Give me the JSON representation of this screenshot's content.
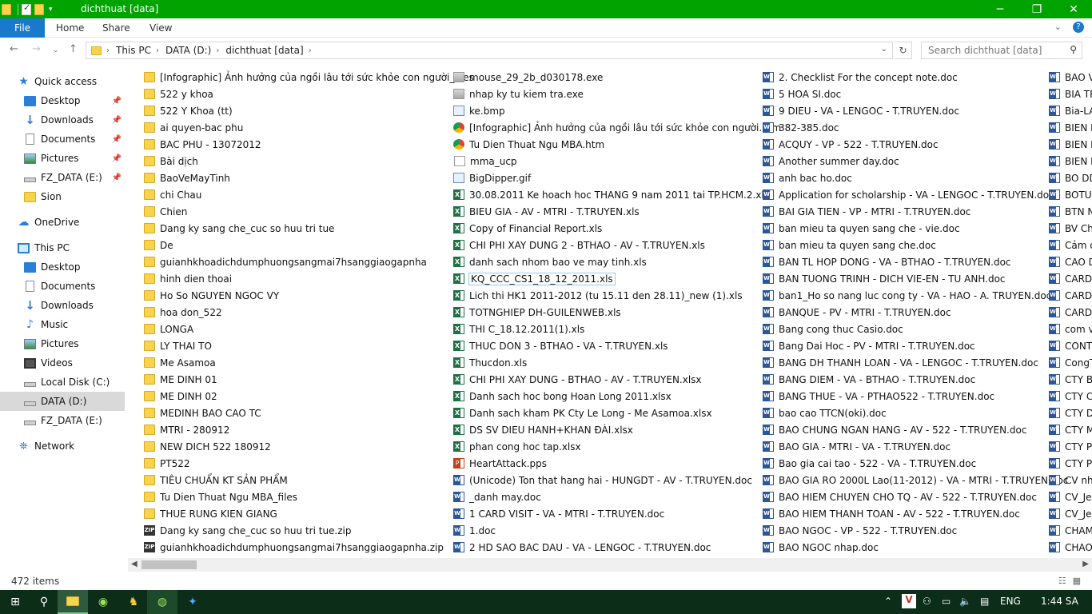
{
  "window": {
    "title": "dichthuat [data]"
  },
  "ribbon": {
    "file": "File",
    "tabs": [
      "Home",
      "Share",
      "View"
    ]
  },
  "address": {
    "segments": [
      "This PC",
      "DATA (D:)",
      "dichthuat [data]"
    ]
  },
  "search": {
    "placeholder": "Search dichthuat [data]"
  },
  "sidebar": {
    "items": [
      {
        "label": "Quick access",
        "icon": "star-icon",
        "pinned": false
      },
      {
        "label": "Desktop",
        "icon": "desktop-icon",
        "pinned": true
      },
      {
        "label": "Downloads",
        "icon": "download-icon",
        "pinned": true
      },
      {
        "label": "Documents",
        "icon": "documents-icon",
        "pinned": true
      },
      {
        "label": "Pictures",
        "icon": "pictures-icon",
        "pinned": true
      },
      {
        "label": "FZ_DATA (E:)",
        "icon": "drive-icon",
        "pinned": true
      },
      {
        "label": "Sion",
        "icon": "folder-icon",
        "pinned": false
      },
      {
        "label": "OneDrive",
        "icon": "cloud-icon",
        "pinned": false
      },
      {
        "label": "This PC",
        "icon": "pc-icon",
        "pinned": false
      },
      {
        "label": "Desktop",
        "icon": "desktop-icon",
        "pinned": false
      },
      {
        "label": "Documents",
        "icon": "documents-icon",
        "pinned": false
      },
      {
        "label": "Downloads",
        "icon": "download-icon",
        "pinned": false
      },
      {
        "label": "Music",
        "icon": "music-icon",
        "pinned": false
      },
      {
        "label": "Pictures",
        "icon": "pictures-icon",
        "pinned": false
      },
      {
        "label": "Videos",
        "icon": "videos-icon",
        "pinned": false
      },
      {
        "label": "Local Disk (C:)",
        "icon": "drive-icon",
        "pinned": false
      },
      {
        "label": "DATA (D:)",
        "icon": "drive-icon",
        "pinned": false,
        "selected": true
      },
      {
        "label": "FZ_DATA (E:)",
        "icon": "drive-icon",
        "pinned": false
      },
      {
        "label": "Network",
        "icon": "network-icon",
        "pinned": false
      }
    ]
  },
  "files": {
    "col1": [
      {
        "name": "[Infographic] Ảnh hưởng của ngồi lâu tới sức khỏe con người_files",
        "type": "folder"
      },
      {
        "name": "522 y khoa",
        "type": "folder"
      },
      {
        "name": "522 Y Khoa (tt)",
        "type": "folder"
      },
      {
        "name": "ai quyen-bac phu",
        "type": "folder"
      },
      {
        "name": "BAC PHU - 13072012",
        "type": "folder"
      },
      {
        "name": "Bài dịch",
        "type": "folder"
      },
      {
        "name": "BaoVeMayTinh",
        "type": "folder"
      },
      {
        "name": "chi Chau",
        "type": "folder"
      },
      {
        "name": "Chien",
        "type": "folder"
      },
      {
        "name": "Dang ky sang che_cuc so huu tri tue",
        "type": "folder"
      },
      {
        "name": "De",
        "type": "folder"
      },
      {
        "name": "guianhkhoadichdumphuongsangmai7hsanggiaogapnha",
        "type": "folder"
      },
      {
        "name": "hinh dien thoai",
        "type": "folder"
      },
      {
        "name": "Ho So NGUYEN NGOC VY",
        "type": "folder"
      },
      {
        "name": "hoa don_522",
        "type": "folder"
      },
      {
        "name": "LONGA",
        "type": "folder"
      },
      {
        "name": "LY THAI TO",
        "type": "folder"
      },
      {
        "name": "Me Asamoa",
        "type": "folder"
      },
      {
        "name": "ME DINH 01",
        "type": "folder"
      },
      {
        "name": "ME DINH 02",
        "type": "folder"
      },
      {
        "name": "MEDINH BAO CAO TC",
        "type": "folder"
      },
      {
        "name": "MTRI - 280912",
        "type": "folder"
      },
      {
        "name": "NEW DICH 522 180912",
        "type": "folder"
      },
      {
        "name": "PT522",
        "type": "folder"
      },
      {
        "name": "TIÊU CHUẨN KT SẢN PHẨM",
        "type": "folder"
      },
      {
        "name": "Tu Dien Thuat Ngu MBA_files",
        "type": "folder"
      },
      {
        "name": "THUE RUNG KIEN GIANG",
        "type": "folder"
      },
      {
        "name": "Dang ky sang che_cuc so huu tri tue.zip",
        "type": "zip"
      },
      {
        "name": "guianhkhoadichdumphuongsangmai7hsanggiaogapnha.zip",
        "type": "zip"
      }
    ],
    "col2": [
      {
        "name": "mouse_29_2b_d030178.exe",
        "type": "exe"
      },
      {
        "name": "nhap ky tu kiem tra.exe",
        "type": "exe"
      },
      {
        "name": "ke.bmp",
        "type": "img"
      },
      {
        "name": "[Infographic] Ảnh hưởng của ngồi lâu tới sức khỏe con người.htm",
        "type": "htm"
      },
      {
        "name": "Tu Dien Thuat Ngu MBA.htm",
        "type": "htm"
      },
      {
        "name": "mma_ucp",
        "type": "plain"
      },
      {
        "name": "BigDipper.gif",
        "type": "img"
      },
      {
        "name": "30.08.2011 Ke hoach hoc THANG 9 nam 2011 tai TP.HCM.2.xls",
        "type": "xls"
      },
      {
        "name": "BIEU GIA - AV - MTRI - T.TRUYEN.xls",
        "type": "xls"
      },
      {
        "name": "Copy of Financial Report.xls",
        "type": "xls"
      },
      {
        "name": "CHI PHI XAY DUNG 2 - BTHAO - AV - T.TRUYEN.xls",
        "type": "xls"
      },
      {
        "name": "danh sach nhom bao ve may tinh.xls",
        "type": "xls"
      },
      {
        "name": "KQ_CCC_CS1_18_12_2011.xls",
        "type": "xls",
        "focus": true
      },
      {
        "name": "Lich thi HK1 2011-2012 (tu 15.11 den 28.11)_new (1).xls",
        "type": "xls"
      },
      {
        "name": "TOTNGHIEP DH-GUILENWEB.xls",
        "type": "xls"
      },
      {
        "name": "THI C_18.12.2011(1).xls",
        "type": "xls"
      },
      {
        "name": "THUC DON 3 - BTHAO - VA - T.TRUYEN.xls",
        "type": "xls"
      },
      {
        "name": "Thucdon.xls",
        "type": "xls"
      },
      {
        "name": "CHI PHI XAY DUNG - BTHAO - AV - T.TRUYEN.xlsx",
        "type": "xls"
      },
      {
        "name": "Danh sach hoc bong Hoan Long 2011.xlsx",
        "type": "xls"
      },
      {
        "name": "Danh sach kham PK Cty Le Long - Me Asamoa.xlsx",
        "type": "xls"
      },
      {
        "name": "DS SV DIEU HANH+KHAN ĐÀI.xlsx",
        "type": "xls"
      },
      {
        "name": "phan cong hoc tap.xlsx",
        "type": "xls"
      },
      {
        "name": "HeartAttack.pps",
        "type": "pps"
      },
      {
        "name": "(Unicode) Ton that hang hai - HUNGDT - AV - T.TRUYEN.doc",
        "type": "doc"
      },
      {
        "name": "_danh may.doc",
        "type": "doc"
      },
      {
        "name": "1 CARD VISIT - VA - MTRI - T.TRUYEN.doc",
        "type": "doc"
      },
      {
        "name": "1.doc",
        "type": "doc"
      },
      {
        "name": "2 HD SAO BAC DAU - VA - LENGOC - T.TRUYEN.doc",
        "type": "doc"
      }
    ],
    "col3": [
      {
        "name": "2. Checklist For the concept note.doc",
        "type": "doc"
      },
      {
        "name": "5 HOA SI.doc",
        "type": "doc"
      },
      {
        "name": "9 DIEU - VA - LENGOC - T.TRUYEN.doc",
        "type": "doc"
      },
      {
        "name": "382-385.doc",
        "type": "doc"
      },
      {
        "name": "ACQUY - VP - 522 - T.TRUYEN.doc",
        "type": "doc"
      },
      {
        "name": "Another summer day.doc",
        "type": "doc"
      },
      {
        "name": "anh bac ho.doc",
        "type": "doc"
      },
      {
        "name": "Application for scholarship - VA - LENGOC - T.TRUYEN.doc",
        "type": "doc"
      },
      {
        "name": "BAI GIA TIEN - VP - MTRI - T.TRUYEN.doc",
        "type": "doc"
      },
      {
        "name": "ban mieu ta quyen sang che - vie.doc",
        "type": "doc"
      },
      {
        "name": "ban mieu ta quyen sang che.doc",
        "type": "doc"
      },
      {
        "name": "BAN TL HOP DONG - VA - BTHAO - T.TRUYEN.doc",
        "type": "doc"
      },
      {
        "name": "BAN TUONG TRINH - DICH VIE-EN - TU ANH.doc",
        "type": "doc"
      },
      {
        "name": "ban1_Ho so nang luc cong ty - VA - HAO - A. TRUYEN.doc",
        "type": "doc"
      },
      {
        "name": "BANQUE - PV - MTRI - T.TRUYEN.doc",
        "type": "doc"
      },
      {
        "name": "Bang cong thuc Casio.doc",
        "type": "doc"
      },
      {
        "name": "Bang Dai Hoc - PV - MTRI - T.TRUYEN.doc",
        "type": "doc"
      },
      {
        "name": "BANG DH THANH LOAN - VA - LENGOC - T.TRUYEN.doc",
        "type": "doc"
      },
      {
        "name": "BANG DIEM - VA - BTHAO - T.TRUYEN.doc",
        "type": "doc"
      },
      {
        "name": "BANG THUE - VA - PTHAO522 - T.TRUYEN.doc",
        "type": "doc"
      },
      {
        "name": "bao cao TTCN(oki).doc",
        "type": "doc"
      },
      {
        "name": "BAO CHUNG NGAN HANG - AV - 522 - T.TRUYEN.doc",
        "type": "doc"
      },
      {
        "name": "BAO GIA  - MTRI - VA - T.TRUYEN.doc",
        "type": "doc"
      },
      {
        "name": "Bao gia cai tao - 522 - VA - T.TRUYEN.doc",
        "type": "doc"
      },
      {
        "name": "BAO GIA RO 2000L Lao(11-2012) - VA - MTRI - T.TRUYEN.doc",
        "type": "doc"
      },
      {
        "name": "BAO HIEM CHUYEN CHO TQ - AV - 522 - T.TRUYEN.doc",
        "type": "doc"
      },
      {
        "name": "BAO HIEM THANH TOAN - AV - 522 - T.TRUYEN.doc",
        "type": "doc"
      },
      {
        "name": "BAO NGOC - VP - 522 - T.TRUYEN.doc",
        "type": "doc"
      },
      {
        "name": "BAO NGOC nhap.doc",
        "type": "doc"
      }
    ],
    "col4": [
      {
        "name": "BAO VI",
        "type": "doc"
      },
      {
        "name": "BIA TR",
        "type": "doc"
      },
      {
        "name": "Bia-LA",
        "type": "doc"
      },
      {
        "name": "BIEN B",
        "type": "doc"
      },
      {
        "name": "BIEN L",
        "type": "doc"
      },
      {
        "name": "BIEN N",
        "type": "doc"
      },
      {
        "name": "BO DD",
        "type": "doc"
      },
      {
        "name": "BOTUL",
        "type": "doc"
      },
      {
        "name": "BTN N",
        "type": "doc"
      },
      {
        "name": "BV Cha",
        "type": "doc"
      },
      {
        "name": "Cảm ơ",
        "type": "doc"
      },
      {
        "name": "CAO D",
        "type": "doc"
      },
      {
        "name": "CARD -",
        "type": "doc"
      },
      {
        "name": "CARD V",
        "type": "doc"
      },
      {
        "name": "CARD V",
        "type": "doc"
      },
      {
        "name": "com va",
        "type": "doc"
      },
      {
        "name": "CONTR",
        "type": "doc"
      },
      {
        "name": "CongT",
        "type": "doc"
      },
      {
        "name": "CTY BA",
        "type": "doc"
      },
      {
        "name": "CTY CU",
        "type": "doc"
      },
      {
        "name": "CTY Du",
        "type": "doc"
      },
      {
        "name": "CTY M",
        "type": "doc"
      },
      {
        "name": "CTY PE",
        "type": "doc"
      },
      {
        "name": "CTY PH",
        "type": "doc"
      },
      {
        "name": "CV nhc",
        "type": "doc"
      },
      {
        "name": "CV_Jen",
        "type": "doc"
      },
      {
        "name": "CV_Jen",
        "type": "doc"
      },
      {
        "name": "CHAM",
        "type": "doc"
      },
      {
        "name": "CHAO",
        "type": "doc"
      }
    ]
  },
  "status": {
    "items": "472 items"
  },
  "taskbar": {
    "lang": "ENG",
    "time": "1:44 SA"
  }
}
